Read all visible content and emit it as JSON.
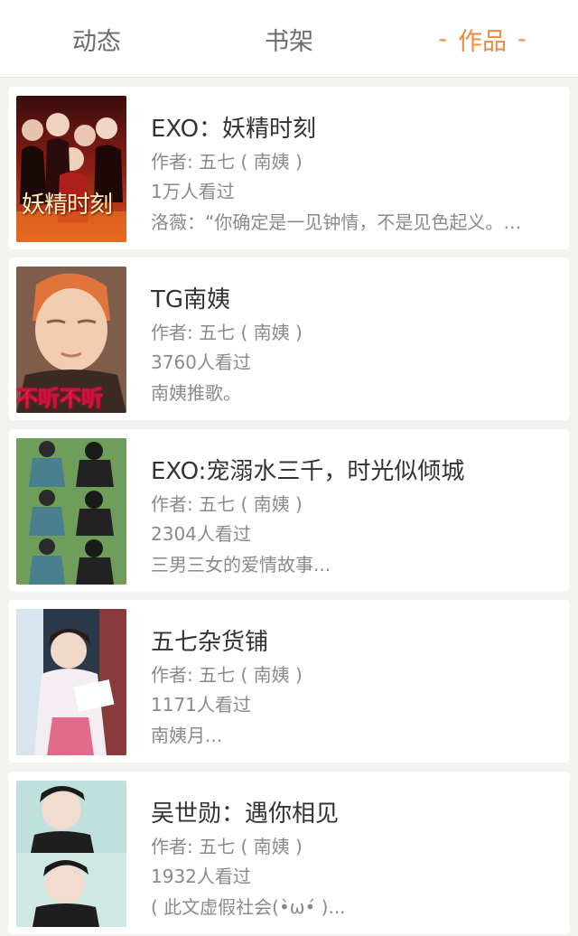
{
  "tabs": [
    {
      "label": "动态",
      "active": false
    },
    {
      "label": "书架",
      "active": false
    },
    {
      "label": "作品",
      "active": true
    }
  ],
  "active_tab_dash": "-",
  "accent_color": "#f0893f",
  "works": [
    {
      "title": "EXO：妖精时刻",
      "author": "作者: 五七 ( 南姨 )",
      "views": "1万人看过",
      "desc": "洛薇：“你确定是一见钟情，不是见色起义。…",
      "cover_text": "妖精时刻",
      "cover_theme": "dark-red-fire"
    },
    {
      "title": "TG南姨",
      "author": "作者: 五七 ( 南姨 )",
      "views": "3760人看过",
      "desc": "南姨推歌。",
      "cover_text": "不听不听",
      "cover_theme": "meme-face"
    },
    {
      "title": "EXO:宠溺水三千，时光似倾城",
      "author": "作者: 五七 ( 南姨 )",
      "views": "2304人看过",
      "desc": "三男三女的爱情故事...",
      "cover_text": "",
      "cover_theme": "green-couple-strip"
    },
    {
      "title": "五七杂货铺",
      "author": "作者: 五七 ( 南姨 )",
      "views": "1171人看过",
      "desc": "南姨月...",
      "cover_text": "",
      "cover_theme": "hanbok-girl"
    },
    {
      "title": "吴世勋：遇你相见",
      "author": "作者: 五七 ( 南姨 )",
      "views": "1932人看过",
      "desc": "( 此文虚假社会(•̀ω•́ )...",
      "cover_text": "",
      "cover_theme": "teal-portrait"
    }
  ]
}
